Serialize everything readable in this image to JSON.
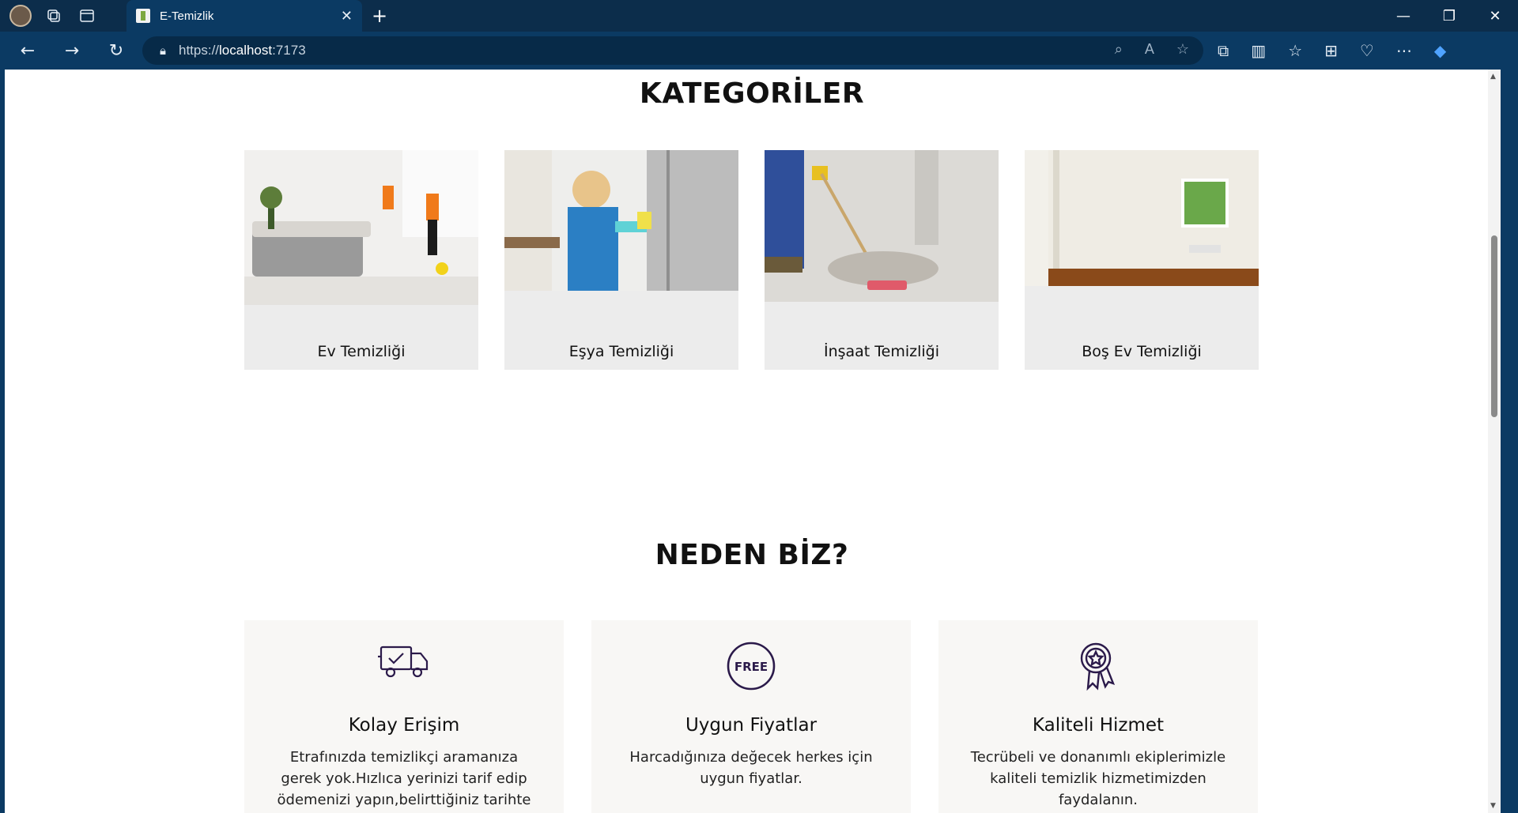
{
  "browser": {
    "tab_title": "E-Temizlik",
    "url_scheme": "https://",
    "url_host": "localhost",
    "url_port": ":7173"
  },
  "page": {
    "categories_title": "KATEGORİLER",
    "categories": [
      {
        "label": "Ev Temizliği"
      },
      {
        "label": "Eşya Temizliği"
      },
      {
        "label": "İnşaat Temizliği"
      },
      {
        "label": "Boş Ev Temizliği"
      }
    ],
    "why_title": "NEDEN BİZ?",
    "features": [
      {
        "title": "Kolay Erişim",
        "text": "Etrafınızda temizlikçi aramanıza gerek yok.Hızlıca yerinizi tarif edip ödemenizi yapın,belirttiğiniz tarihte kapınızda olalım.",
        "icon": "delivery-truck-icon"
      },
      {
        "title": "Uygun Fiyatlar",
        "text": "Harcadığınıza değecek herkes için uygun fiyatlar.",
        "icon": "free-badge-icon",
        "icon_text": "FREE"
      },
      {
        "title": "Kaliteli Hizmet",
        "text": "Tecrübeli ve donanımlı ekiplerimizle kaliteli temizlik hizmetimizden faydalanın.",
        "icon": "award-ribbon-icon"
      }
    ],
    "accent_color": "#2b1a4a"
  }
}
